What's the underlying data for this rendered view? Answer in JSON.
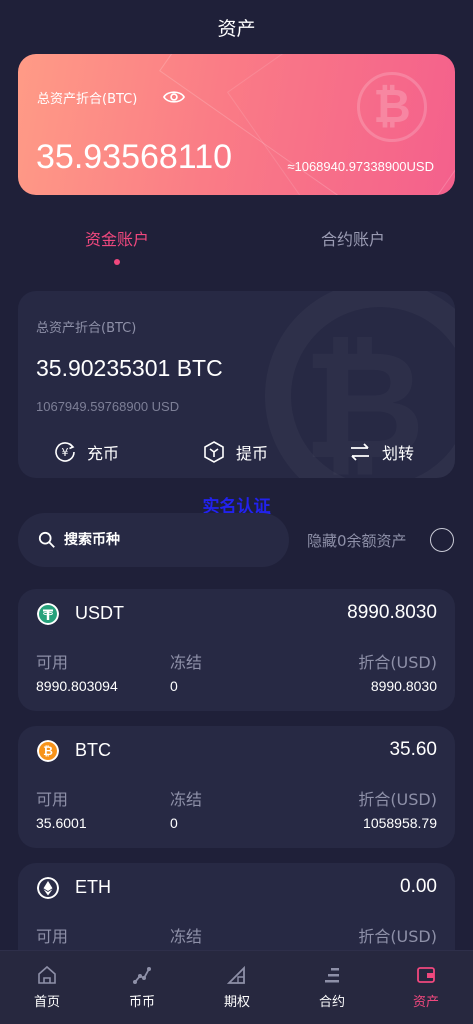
{
  "header": {
    "title": "资产"
  },
  "hero": {
    "label": "总资产折合(BTC)",
    "value": "35.93568110",
    "usd": "≈1068940.97338900USD",
    "watermark": "₿"
  },
  "tabs": [
    {
      "label": "资金账户",
      "active": true
    },
    {
      "label": "合约账户",
      "active": false
    }
  ],
  "account": {
    "label": "总资产折合(BTC)",
    "value": "35.90235301 BTC",
    "usd": "1067949.59768900 USD",
    "actions": {
      "deposit": "充币",
      "withdraw": "提币",
      "transfer": "划转"
    }
  },
  "real_auth_link": "实名认证",
  "search": {
    "placeholder": "搜索币种"
  },
  "hide_zero_label": "隐藏0余额资产",
  "columns": {
    "available": "可用",
    "frozen": "冻结",
    "converted": "折合(USD)"
  },
  "coins": [
    {
      "symbol": "USDT",
      "total": "8990.8030",
      "available": "8990.803094",
      "frozen": "0",
      "converted": "8990.8030",
      "icon": "tether-icon",
      "color": "#26a17b"
    },
    {
      "symbol": "BTC",
      "total": "35.60",
      "available": "35.6001",
      "frozen": "0",
      "converted": "1058958.79",
      "icon": "bitcoin-icon",
      "color": "#f7931a"
    },
    {
      "symbol": "ETH",
      "total": "0.00",
      "available": "",
      "frozen": "",
      "converted": "",
      "icon": "ethereum-icon",
      "color": "#ffffff"
    }
  ],
  "nav": [
    {
      "label": "首页",
      "icon": "home-icon",
      "active": false
    },
    {
      "label": "币币",
      "icon": "spot-icon",
      "active": false
    },
    {
      "label": "期权",
      "icon": "options-icon",
      "active": false
    },
    {
      "label": "合约",
      "icon": "contract-icon",
      "active": false
    },
    {
      "label": "资产",
      "icon": "wallet-icon",
      "active": true
    }
  ],
  "colors": {
    "accent": "#f0487e",
    "background": "#1f2039",
    "card": "#272944"
  }
}
